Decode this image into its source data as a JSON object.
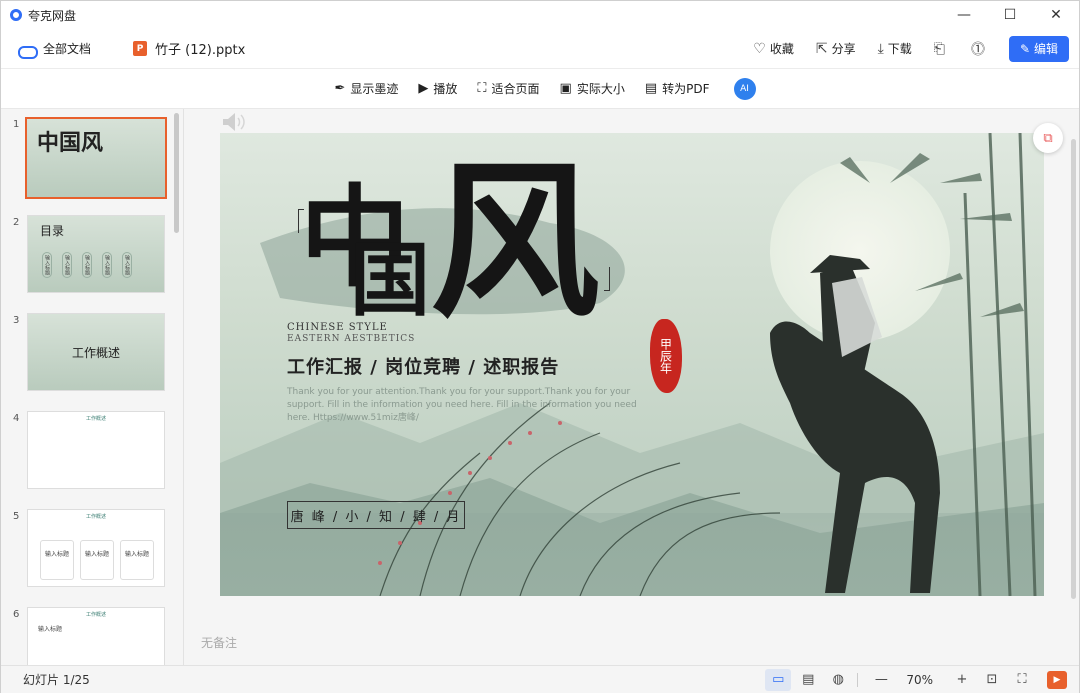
{
  "app": {
    "name": "夸克网盘"
  },
  "window": {
    "minimize": "—",
    "maximize": "☐",
    "close": "✕"
  },
  "breadcrumb": {
    "root": "全部文档",
    "file": "竹子 (12).pptx",
    "file_icon": "P"
  },
  "file_actions": {
    "favorite": "收藏",
    "share": "分享",
    "download": "下载",
    "edit": "编辑"
  },
  "toolbar": {
    "ink": "显示墨迹",
    "play": "播放",
    "fit_page": "适合页面",
    "actual_size": "实际大小",
    "to_pdf": "转为PDF",
    "ai": "AI"
  },
  "thumbnails": [
    {
      "num": "1",
      "title": "中国风"
    },
    {
      "num": "2",
      "title": "目录",
      "items": [
        "输入标题",
        "输入标题",
        "输入标题",
        "输入标题",
        "输入标题"
      ]
    },
    {
      "num": "3",
      "title": "工作概述"
    },
    {
      "num": "4",
      "title": "工作概述"
    },
    {
      "num": "5",
      "title": "工作概述",
      "items": [
        "输入标题",
        "输入标题",
        "输入标题"
      ]
    },
    {
      "num": "6",
      "title": "工作概述",
      "items": [
        "输入标题"
      ]
    }
  ],
  "slide": {
    "title_zhong": "中",
    "title_guo": "国",
    "title_feng": "风",
    "sub_en1": "CHINESE STYLE",
    "sub_en2": "EASTERN AESTBETICS",
    "headline": "工作汇报 / 岗位竞聘 / 述职报告",
    "body": "Thank you for your attention.Thank you for your support.Thank you for your support. Fill in the information you need here. Fill in the information you need here. Https://www.51miz唐峰/",
    "name": "唐 峰 / 小 / 知 / 肆 / 月",
    "seal": "甲辰年"
  },
  "notes_placeholder": "无备注",
  "status": {
    "slide_count": "幻灯片 1/25",
    "zoom": "70%"
  }
}
